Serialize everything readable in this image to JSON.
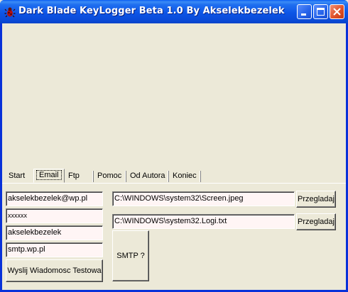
{
  "window": {
    "title": "Dark Blade KeyLogger Beta 1.0 By Akselekbezelek",
    "icon": "bug-icon"
  },
  "tabs": [
    {
      "label": "Start"
    },
    {
      "label": "Email"
    },
    {
      "label": "Ftp"
    },
    {
      "label": "Pomoc"
    },
    {
      "label": "Od Autora"
    },
    {
      "label": "Koniec"
    }
  ],
  "active_tab": "Email",
  "email": {
    "address": "akselekbezelek@wp.pl",
    "password_mask": "xxxxxx",
    "username": "akselekbezelek",
    "smtp_server": "smtp.wp.pl",
    "send_test_label": "Wyslij Wiadomosc Testowa"
  },
  "paths": {
    "screen_path": "C:\\WINDOWS\\system32\\Screen.jpeg",
    "log_path": "C:\\WINDOWS\\system32.Logi.txt",
    "browse_label": "Przegladaj"
  },
  "smtp_help_label": "SMTP ?",
  "colors": {
    "titlebar": "#0a55e6",
    "face": "#ece9d8",
    "field_bg": "#fff5f5",
    "close_button": "#e0522a"
  }
}
